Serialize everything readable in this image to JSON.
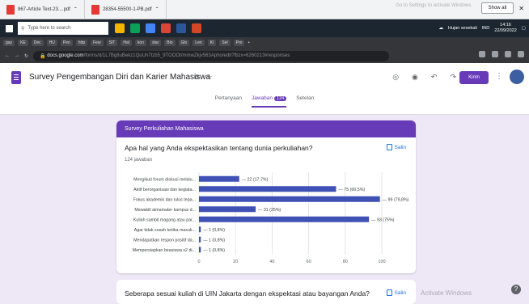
{
  "downloads": {
    "items": [
      "867-Article Text-23....pdf",
      "28354-55500-1-PB.pdf"
    ],
    "show_all": "Show all",
    "watermark_top": "Go to Settings to activate Windows."
  },
  "taskbar": {
    "search_placeholder": "Type here to search",
    "weather": "Hujan sesekali",
    "lang": "IND",
    "time": "14:16",
    "date": "22/09/2022"
  },
  "browser": {
    "url_host": "docs.google.com",
    "url_path": "/forms/d/1L7Bg8uBekz1QuUn7tzb5_9TOOOt/mmwZkjv563Apho/edit?fbzx=6260213#responses"
  },
  "form": {
    "title": "Survey Pengembangan Diri dan Karier Mahasiswa",
    "send_label": "Kirim",
    "tabs": [
      "Pertanyaan",
      "Jawaban",
      "Setelan"
    ],
    "response_count": "124",
    "section_title": "Survey Perkuliahan Mahasiswa",
    "copy_label": "Salin"
  },
  "chart_data": {
    "type": "bar",
    "orientation": "horizontal",
    "title": "Apa hal yang Anda ekspektasikan tentang dunia perkuliahan?",
    "subtitle": "124 jawaban",
    "categories": [
      "Mengikuti forum diskusi melalu...",
      "Aktif berorganisasi dan kegiata...",
      "Fokus akademik dan lulus tepa...",
      "Mewakili almamater kampus d...",
      "Kuliah sambil magang atau par...",
      "Agar tidak susah ketika masuk...",
      "Mendapatkan respon positif da...",
      "Mempersiapkan beasiswa s2 di..."
    ],
    "values": [
      22,
      75,
      99,
      31,
      93,
      1,
      1,
      1
    ],
    "labels": [
      "22 (17,7%)",
      "75 (60,5%)",
      "99 (79,8%)",
      "31 (25%)",
      "93 (75%)",
      "1 (0,8%)",
      "1 (0,8%)",
      "1 (0,8%)"
    ],
    "xlim": [
      0,
      100
    ],
    "xticks": [
      0,
      20,
      40,
      60,
      80,
      100
    ],
    "grid": true,
    "color": "#3f51b5"
  },
  "next_question": "Seberapa sesuai kuliah di UIN Jakarta dengan ekspektasi atau bayangan Anda?",
  "watermark_bottom": "Activate Windows"
}
